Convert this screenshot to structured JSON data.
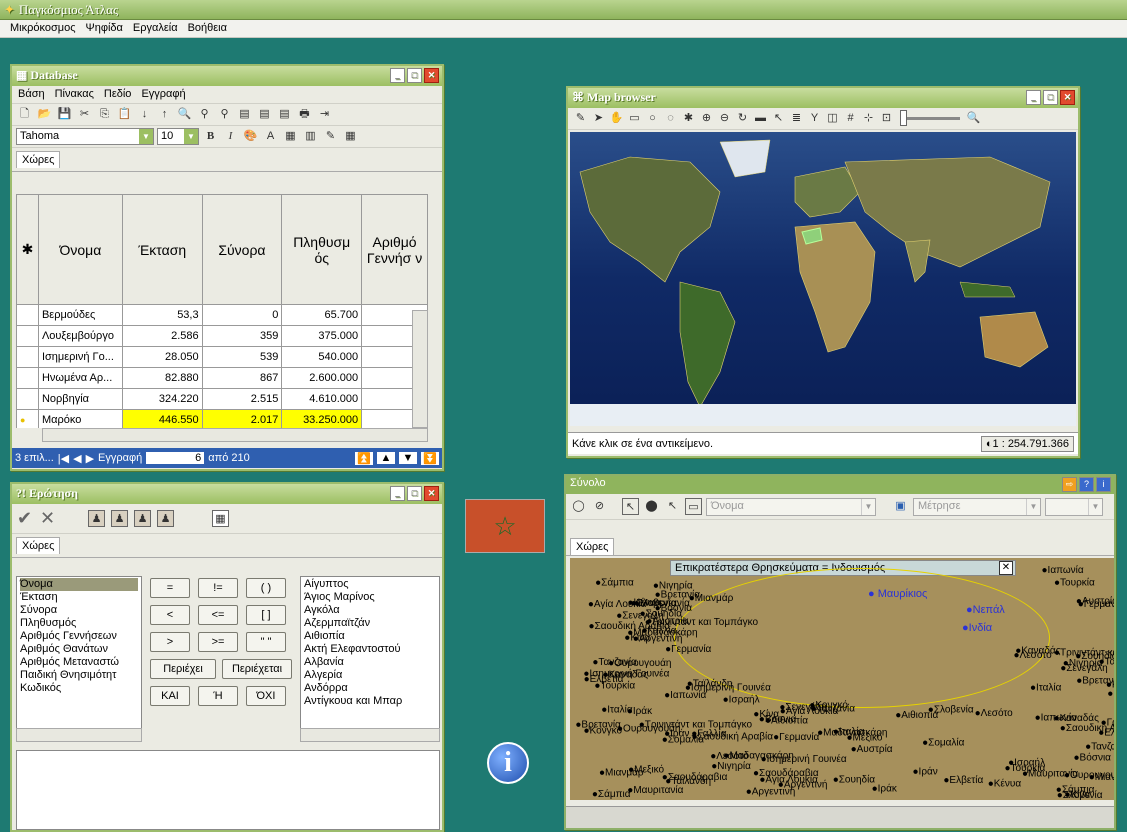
{
  "app": {
    "title": "Παγκόσμιος Άτλας",
    "menu": [
      "Μικρόκοσμος",
      "Ψηφίδα",
      "Εργαλεία",
      "Βοήθεια"
    ]
  },
  "database": {
    "title": "Database",
    "menu": [
      "Βάση",
      "Πίνακας",
      "Πεδίο",
      "Εγγραφή"
    ],
    "font": "Tahoma",
    "size": "10",
    "tab": "Χώρες",
    "columns": [
      "Όνομα",
      "Έκταση",
      "Σύνορα",
      "Πληθυσμ ός",
      "Αριθμό Γεννήσ ν"
    ],
    "rows": [
      [
        "Βερμούδες",
        "53,3",
        "0",
        "65.700"
      ],
      [
        "Λουξεμβούργο",
        "2.586",
        "359",
        "375.000"
      ],
      [
        "Ισημερινή Γο...",
        "28.050",
        "539",
        "540.000"
      ],
      [
        "Ηνωμένα Αρ...",
        "82.880",
        "867",
        "2.600.000"
      ],
      [
        "Νορβηγία",
        "324.220",
        "2.515",
        "4.610.000"
      ],
      [
        "Μαρόκο",
        "446.550",
        "2.017",
        "33.250.000"
      ]
    ],
    "status": {
      "sel": "3 επιλ...",
      "record_label": "Εγγραφή",
      "record": "6",
      "of": "από 210"
    }
  },
  "query": {
    "title": "Ερώτηση",
    "tab": "Χώρες",
    "fields": [
      "Όνομα",
      "Έκταση",
      "Σύνορα",
      "Πληθυσμός",
      "Αριθμός Γεννήσεων",
      "Αριθμός Θανάτων",
      "Αριθμός Μεταναστώ",
      "Παιδική Θνησιμότητ",
      "Κωδικός"
    ],
    "operators": [
      "=",
      "!=",
      "( )",
      "<",
      "<=",
      "[ ]",
      ">",
      ">=",
      "\" \""
    ],
    "contains": "Περιέχει",
    "contained": "Περιέχεται",
    "and": "ΚΑΙ",
    "or": "Ή",
    "not": "ΌΧΙ",
    "values": [
      "Αίγυπτος",
      "Άγιος Μαρίνος",
      "Αγκόλα",
      "Αζερμπαϊτζάν",
      "Αιθιοπία",
      "Ακτή Ελεφαντοστού",
      "Αλβανία",
      "Αλγερία",
      "Ανδόρρα",
      "Αντίγκουα και Μπαρ"
    ]
  },
  "map": {
    "title": "Map browser",
    "status": "Κάνε κλικ σε ένα αντικείμενο.",
    "scale": "1 : 254.791.366"
  },
  "set": {
    "title": "Σύνολο",
    "field": "Όνομα",
    "measure": "Μέτρησε",
    "tab": "Χώρες",
    "popup": "Επικρατέστερα Θρησκεύματα = Ινδουισμός",
    "highlighted": [
      "Μαυρίκιος",
      "Νεπάλ",
      "Ινδία"
    ],
    "visible_labels": [
      "Αργεντινή",
      "Αγία Λουκία",
      "Μαδαγασκάρη",
      "Ισημερινή Γουινέα",
      "Τρινιντάντ και Τομπάγκο",
      "Ουρουγουάη",
      "Νιγηρία",
      "Μαυριτανία",
      "Βρετανία",
      "Γαλλία",
      "Σάμπια",
      "Ταϊλάνδη",
      "Σαουδική Αραβία",
      "Μιανμάρ",
      "Κίνα",
      "Βόσνια",
      "Τουρκία",
      "Κένυα",
      "Σουηδία",
      "Τανζανία",
      "Σενεγάλη",
      "Ελβετία",
      "Καναδάς",
      "Σλοβενία",
      "Αυστρία",
      "Γερμανία",
      "Ιταλία",
      "Ιαπωνία",
      "Κονγκό",
      "Λεσότο",
      "Αιθιοπία",
      "Σομαλία",
      "Σαουδάραβια",
      "Ιράν",
      "Ιράκ",
      "Ισραήλ",
      "Μεξικό"
    ]
  }
}
